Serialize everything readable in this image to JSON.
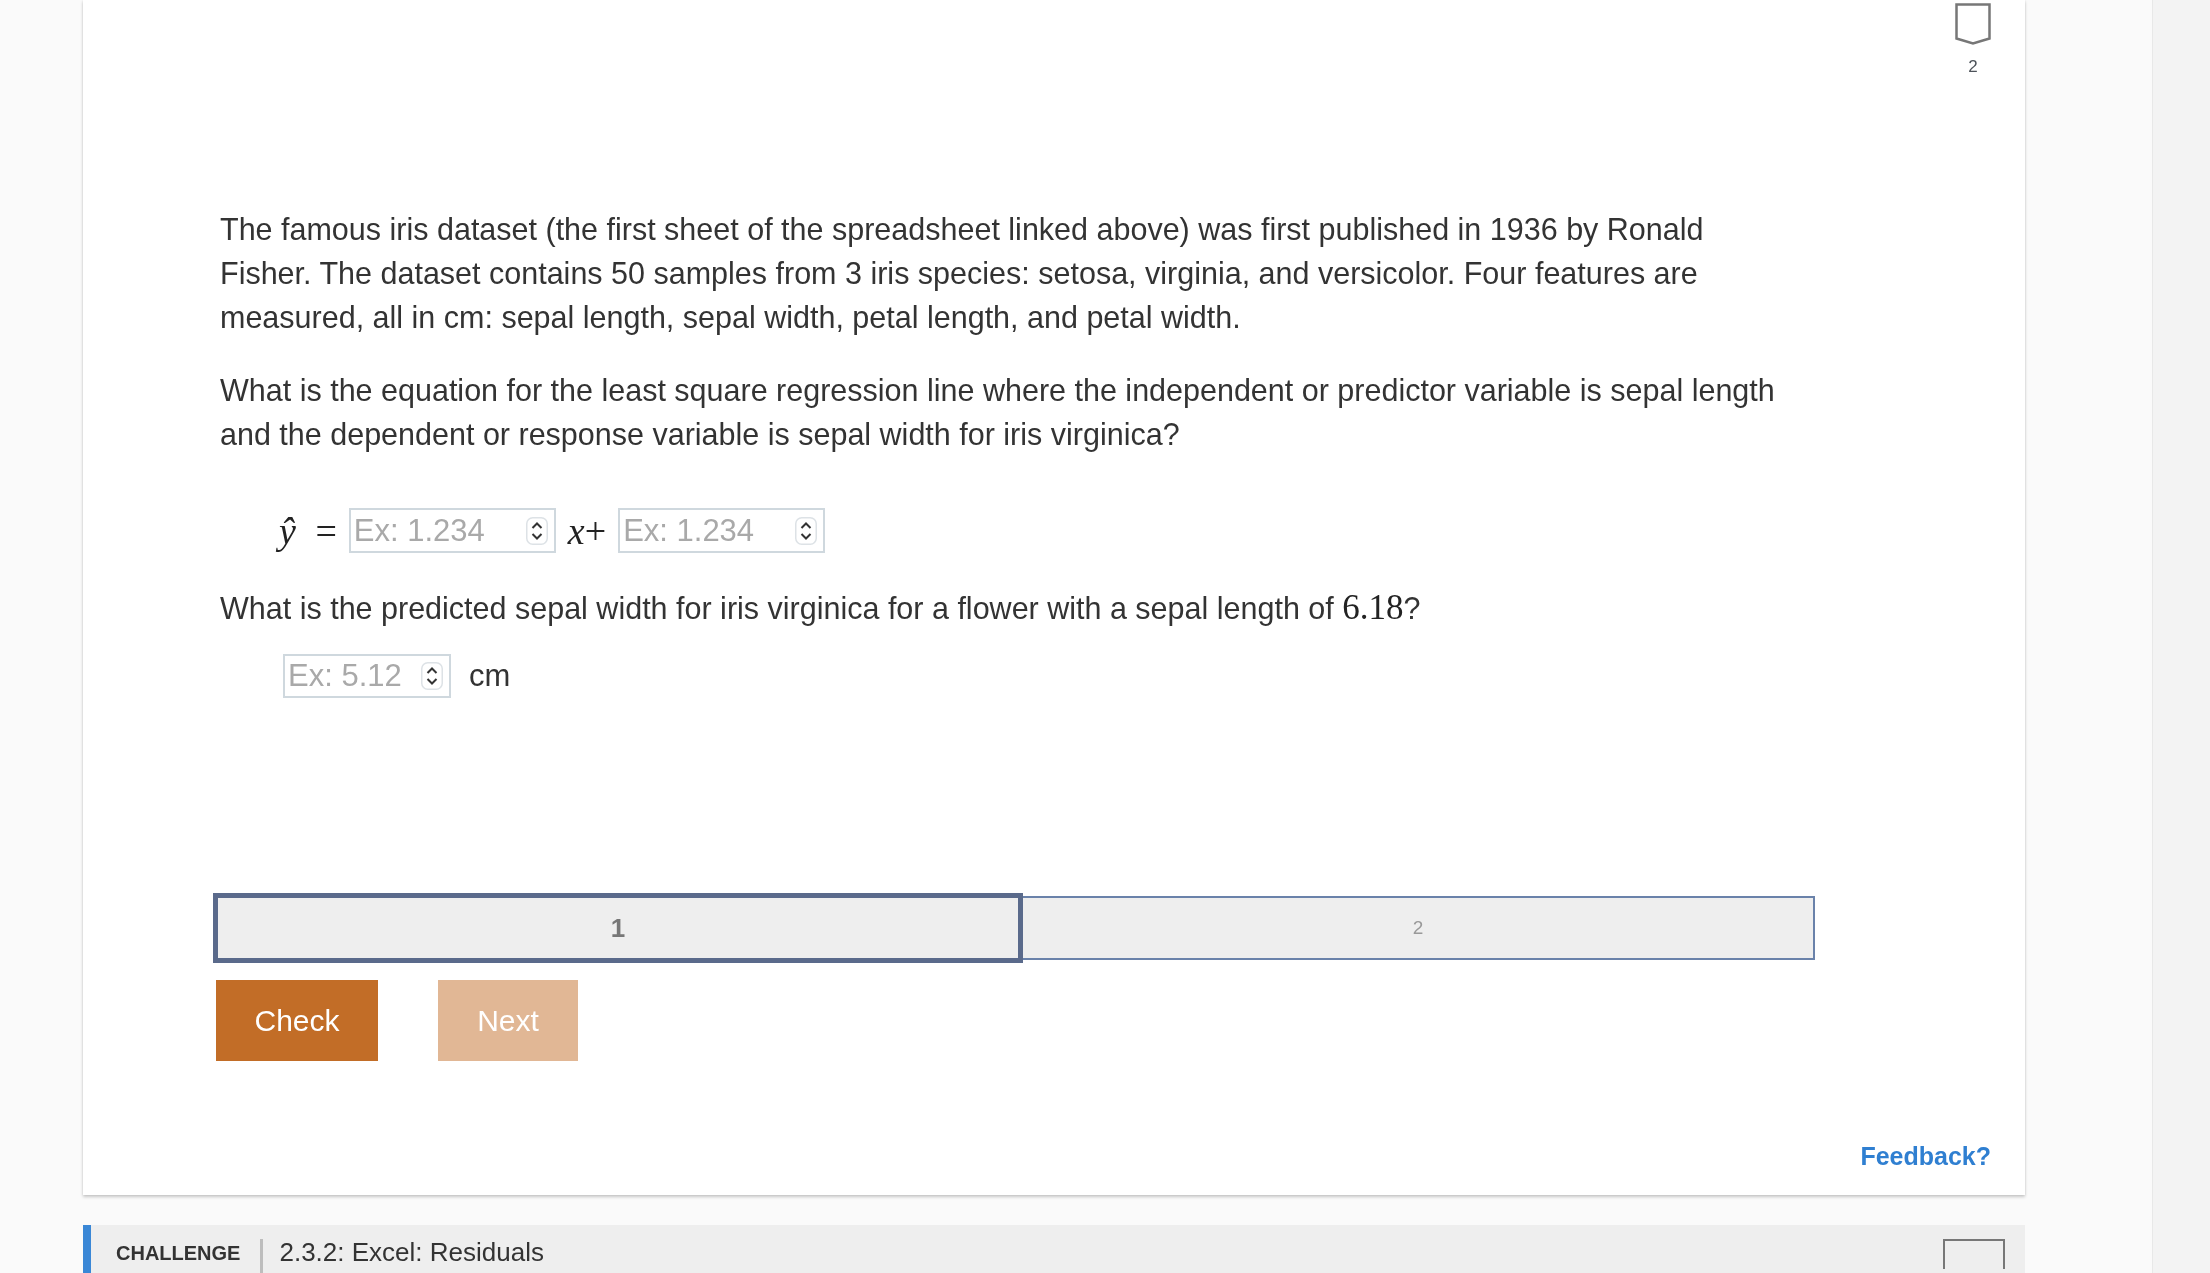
{
  "badge": {
    "label": "2"
  },
  "passage": "The famous iris dataset (the first sheet of the spreadsheet linked above) was first published in 1936 by Ronald Fisher. The dataset contains 50 samples from 3 iris species: setosa, virginia, and versicolor. Four features are measured, all in cm: sepal length, sepal width, petal length, and petal width.",
  "question": "What is the equation for the least square regression line where the independent or predictor variable is sepal length and the dependent or response variable is sepal width for iris virginica?",
  "equation": [
    {
      "kind": "math",
      "text": "*ŷ* ="
    },
    {
      "kind": "input",
      "placeholder": "Ex: 1.234"
    },
    {
      "kind": "math",
      "text": "*x*+"
    },
    {
      "kind": "input",
      "placeholder": "Ex: 1.234"
    }
  ],
  "prediction_question": [
    {
      "kind": "text",
      "text": "What is the predicted sepal width for iris virginica for a flower with a sepal length of "
    },
    {
      "kind": "math",
      "text": "6.18"
    },
    {
      "kind": "text",
      "text": "?"
    }
  ],
  "answer": {
    "placeholder": "Ex: 5.12",
    "unit": "cm"
  },
  "steps": [
    {
      "label": "1",
      "selected": true
    },
    {
      "label": "2",
      "selected": false
    }
  ],
  "buttons": [
    {
      "label": "Check",
      "disabled": false
    },
    {
      "label": "Next",
      "disabled": true
    }
  ],
  "feedback_link": "Feedback?",
  "next_activity": {
    "tag": "CHALLENGE",
    "title": "2.3.2: Excel: Residuals"
  }
}
